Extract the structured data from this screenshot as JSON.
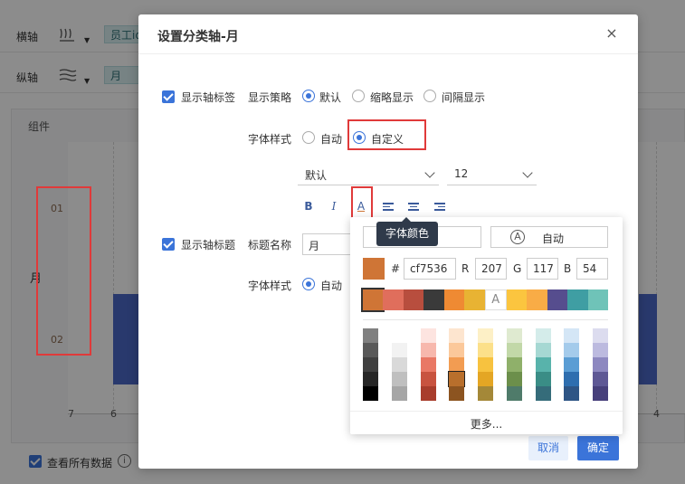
{
  "background": {
    "x_axis_label": "横轴",
    "x_axis_chip": "员工id",
    "y_axis_label": "纵轴",
    "y_axis_chip": "月",
    "panel_title": "组件",
    "chart_y_title": "月",
    "y_ticks": [
      "01",
      "02"
    ],
    "x_ticks": [
      "7",
      "6",
      "4"
    ],
    "bottom_checkbox": "查看所有数据",
    "info_icon": "i"
  },
  "dialog": {
    "title": "设置分类轴-月",
    "close_icon": "×",
    "show_axis_label": "显示轴标签",
    "display_strategy_label": "显示策略",
    "strategy_options": [
      "默认",
      "缩略显示",
      "间隔显示"
    ],
    "font_style_label": "字体样式",
    "font_style_options": [
      "自动",
      "自定义"
    ],
    "font_family": "默认",
    "font_size": "12",
    "toolbar": {
      "bold": "B",
      "italic": "I",
      "font_color": "A"
    },
    "show_axis_title": "显示轴标题",
    "title_name_label": "标题名称",
    "title_name_value": "月",
    "font_style_label_2": "字体样式",
    "font_style_2_option": "自动",
    "cancel": "取消",
    "ok": "确定"
  },
  "tooltip": "字体颜色",
  "picker": {
    "auto_label": "自动",
    "auto_icon_letter": "A",
    "hash": "#",
    "hex": "cf7536",
    "r_label": "R",
    "r": "207",
    "g_label": "G",
    "g": "117",
    "b_label": "B",
    "b": "54",
    "current_color": "#cf7536",
    "recent_colors": [
      "#cf7536",
      "#e06e5c",
      "#b84e3e",
      "#3a3a3a",
      "#ef8a33",
      "#e8b333",
      "#ffffff",
      "#fbc53f",
      "#f9ac46",
      "#564d8e",
      "#3f9ea3",
      "#6fc3b8"
    ],
    "recent_letter": "A",
    "palette": [
      [
        "#808080",
        "#595959",
        "#404040",
        "#262626",
        "#000000"
      ],
      [
        "#ffffff",
        "#f2f2f2",
        "#d9d9d9",
        "#bfbfbf",
        "#a6a6a6"
      ],
      [
        "#fde4e0",
        "#f7b8ad",
        "#e97865",
        "#c8533f",
        "#a83d2c"
      ],
      [
        "#fde5cf",
        "#fbc89a",
        "#f29c52",
        "#b86f2c",
        "#8c5420"
      ],
      [
        "#fdf0c6",
        "#fce08a",
        "#f7c23f",
        "#e4a624",
        "#a48838"
      ],
      [
        "#dfead0",
        "#c2d8a8",
        "#8fb06a",
        "#6c8f4b",
        "#4f7b6a"
      ],
      [
        "#d4ecea",
        "#a6d8d3",
        "#58b3ab",
        "#3a8d86",
        "#356c7a"
      ],
      [
        "#d4e6f6",
        "#a4cbeb",
        "#5a9dd4",
        "#2e6eaf",
        "#2e5585"
      ],
      [
        "#dcdcef",
        "#bcbadf",
        "#8d88c0",
        "#5e5895",
        "#47407b"
      ]
    ],
    "more": "更多..."
  }
}
